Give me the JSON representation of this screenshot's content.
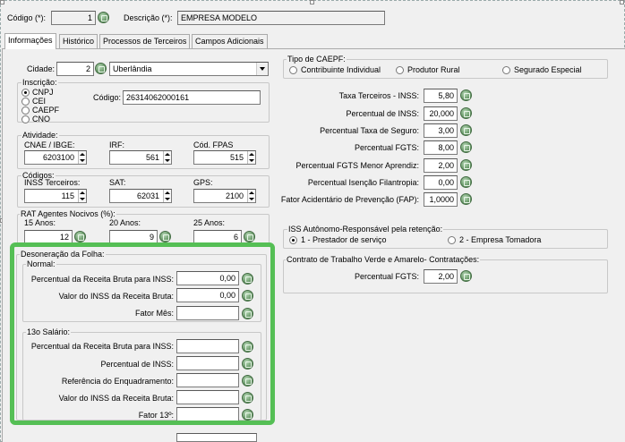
{
  "header": {
    "codigo_label": "Código (*):",
    "codigo_value": "1",
    "descricao_label": "Descrição (*):",
    "descricao_value": "EMPRESA MODELO"
  },
  "tabs": [
    "Informações",
    "Histórico",
    "Processos de Terceiros",
    "Campos Adicionais"
  ],
  "cidade": {
    "label": "Cidade:",
    "code": "2",
    "name": "Uberlândia"
  },
  "inscricao": {
    "title": "Inscrição:",
    "options": [
      "CNPJ",
      "CEI",
      "CAEPF",
      "CNO"
    ],
    "selected": "CNPJ",
    "codigo_label": "Código:",
    "codigo_value": "26314062000161"
  },
  "atividade": {
    "title": "Atividade:",
    "cnae_label": "CNAE / IBGE:",
    "cnae_value": "6203100",
    "irf_label": "IRF:",
    "irf_value": "561",
    "fpas_label": "Cód. FPAS",
    "fpas_value": "515"
  },
  "codigos": {
    "title": "Códigos:",
    "inss_label": "INSS Terceiros:",
    "inss_value": "115",
    "sat_label": "SAT:",
    "sat_value": "62031",
    "gps_label": "GPS:",
    "gps_value": "2100"
  },
  "rat": {
    "title": "RAT Agentes Nocivos (%):",
    "a15_label": "15 Anos:",
    "a15_value": "12",
    "a20_label": "20 Anos:",
    "a20_value": "9",
    "a25_label": "25 Anos:",
    "a25_value": "6"
  },
  "desoneracao": {
    "title": "Desoneração da Folha:",
    "normal": {
      "title": "Normal:",
      "rows": [
        {
          "label": "Percentual da Receita Bruta para INSS:",
          "value": "0,00"
        },
        {
          "label": "Valor do INSS da Receita Bruta:",
          "value": "0,00"
        },
        {
          "label": "Fator Mês:",
          "value": ""
        }
      ]
    },
    "decimo": {
      "title": "13o Salário:",
      "rows": [
        {
          "label": "Percentual da Receita Bruta para INSS:",
          "value": ""
        },
        {
          "label": "Percentual de INSS:",
          "value": ""
        },
        {
          "label": "Referência do Enquadramento:",
          "value": ""
        },
        {
          "label": "Valor do INSS da Receita Bruta:",
          "value": ""
        },
        {
          "label": "Fator 13º:",
          "value": ""
        }
      ]
    }
  },
  "caepf": {
    "title": "Tipo de CAEPF:",
    "options": [
      "Contribuinte Individual",
      "Produtor Rural",
      "Segurado Especial"
    ]
  },
  "taxas": [
    {
      "label": "Taxa Terceiros - INSS:",
      "value": "5,80"
    },
    {
      "label": "Percentual de INSS:",
      "value": "20,000"
    },
    {
      "label": "Percentual Taxa de Seguro:",
      "value": "3,00"
    },
    {
      "label": "Percentual FGTS:",
      "value": "8,00"
    },
    {
      "label": "Percentual FGTS Menor Aprendiz:",
      "value": "2,00"
    },
    {
      "label": "Percentual Isenção Filantropia:",
      "value": "0,00"
    },
    {
      "label": "Fator Acidentário de Prevenção (FAP):",
      "value": "1,0000"
    }
  ],
  "iss": {
    "title": "ISS Autônomo-Responsável pela retenção:",
    "opt1": "1 - Prestador de serviço",
    "opt2": "2 - Empresa Tomadora"
  },
  "contrato": {
    "title": "Contrato de Trabalho Verde e Amarelo- Contratações:",
    "fgts_label": "Percentual FGTS:",
    "fgts_value": "2,00"
  },
  "colors": {
    "highlight": "#55bf55",
    "calc_icon": "#5d8f5d"
  }
}
